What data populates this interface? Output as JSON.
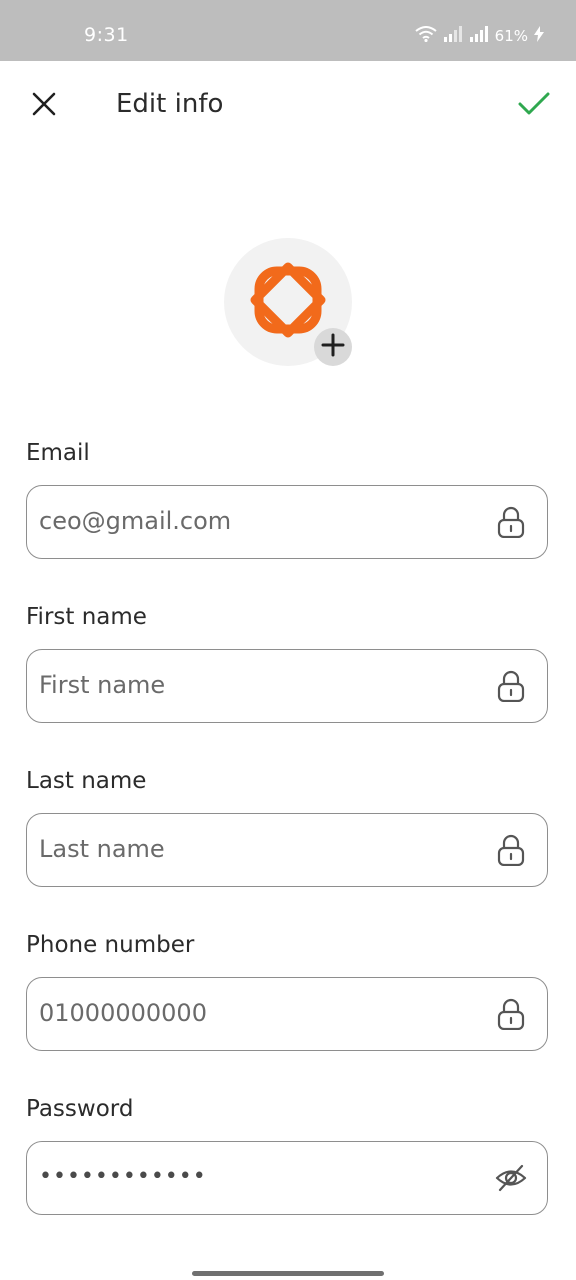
{
  "status_bar": {
    "time": "9:31",
    "battery": "61%",
    "icons": [
      "wifi-icon",
      "signal-icon",
      "signal-icon",
      "charging-icon"
    ]
  },
  "header": {
    "title": "Edit info",
    "close_icon": "close-icon",
    "confirm_icon": "check-icon",
    "confirm_color": "#2fa84f"
  },
  "avatar": {
    "logo_icon": "brand-logo-icon",
    "logo_color": "#f26a1b",
    "add_icon": "plus-icon"
  },
  "form": {
    "fields": [
      {
        "label": "Email",
        "value": "ceo@gmail.com",
        "icon": "lock-icon"
      },
      {
        "label": "First name",
        "value": "First name",
        "icon": "lock-icon"
      },
      {
        "label": "Last name",
        "value": "Last name",
        "icon": "lock-icon"
      },
      {
        "label": "Phone number",
        "value": "01000000000",
        "icon": "lock-icon"
      },
      {
        "label": "Password",
        "value": "••••••••••••",
        "icon": "eye-off-icon"
      }
    ]
  }
}
